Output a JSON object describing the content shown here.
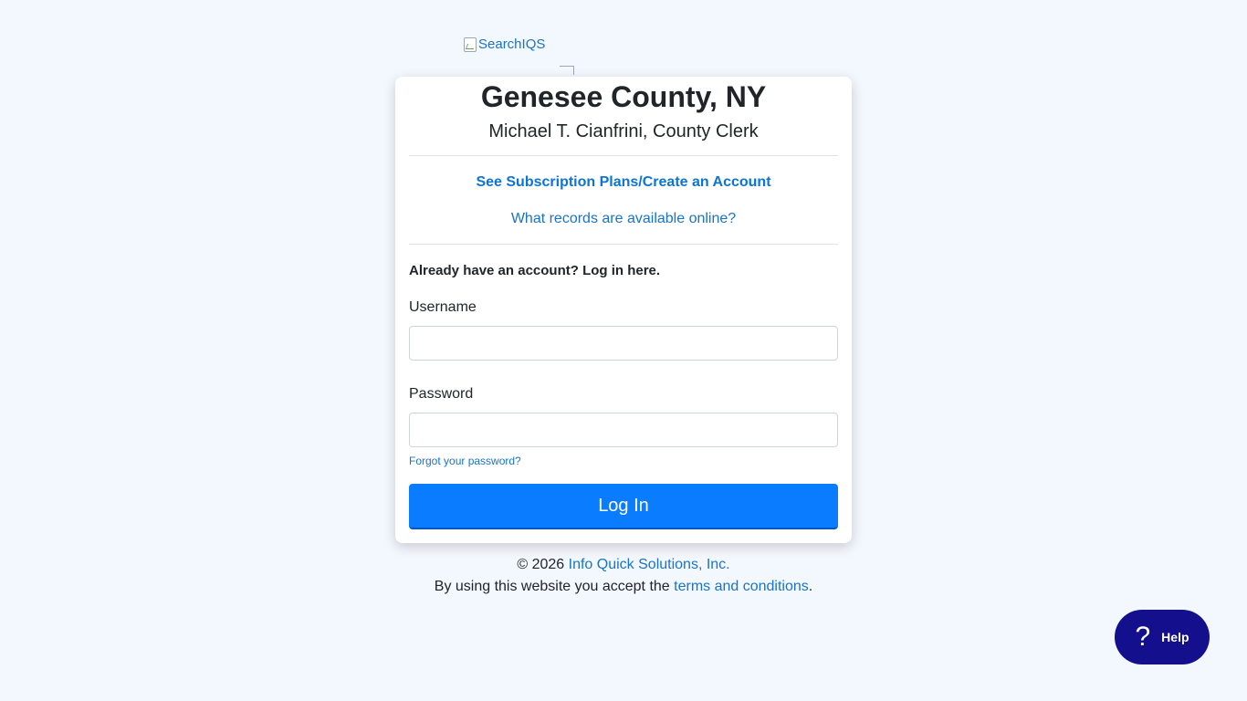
{
  "logo": {
    "alt_text": "SearchIQS"
  },
  "header": {
    "county_title": "Genesee County, NY",
    "clerk_name": "Michael T. Cianfrini, County Clerk"
  },
  "links": {
    "subscribe": "See Subscription Plans/Create an Account",
    "records": "What records are available online?"
  },
  "login": {
    "heading": "Already have an account? Log in here.",
    "username_label": "Username",
    "username_value": "",
    "password_label": "Password",
    "password_value": "",
    "forgot_password": "Forgot your password?",
    "button_label": "Log In"
  },
  "footer": {
    "copyright": "© 2026",
    "company": "Info Quick Solutions, Inc.",
    "terms_prefix": "By using this website you accept the",
    "terms_link": "terms and conditions",
    "terms_suffix": "."
  },
  "help": {
    "icon": "question-mark-icon",
    "label": "Help"
  },
  "colors": {
    "accent": "#0a7cff",
    "link": "#1a73c8",
    "help_bg": "#140f8c",
    "page_bg": "#f3f8fe"
  }
}
